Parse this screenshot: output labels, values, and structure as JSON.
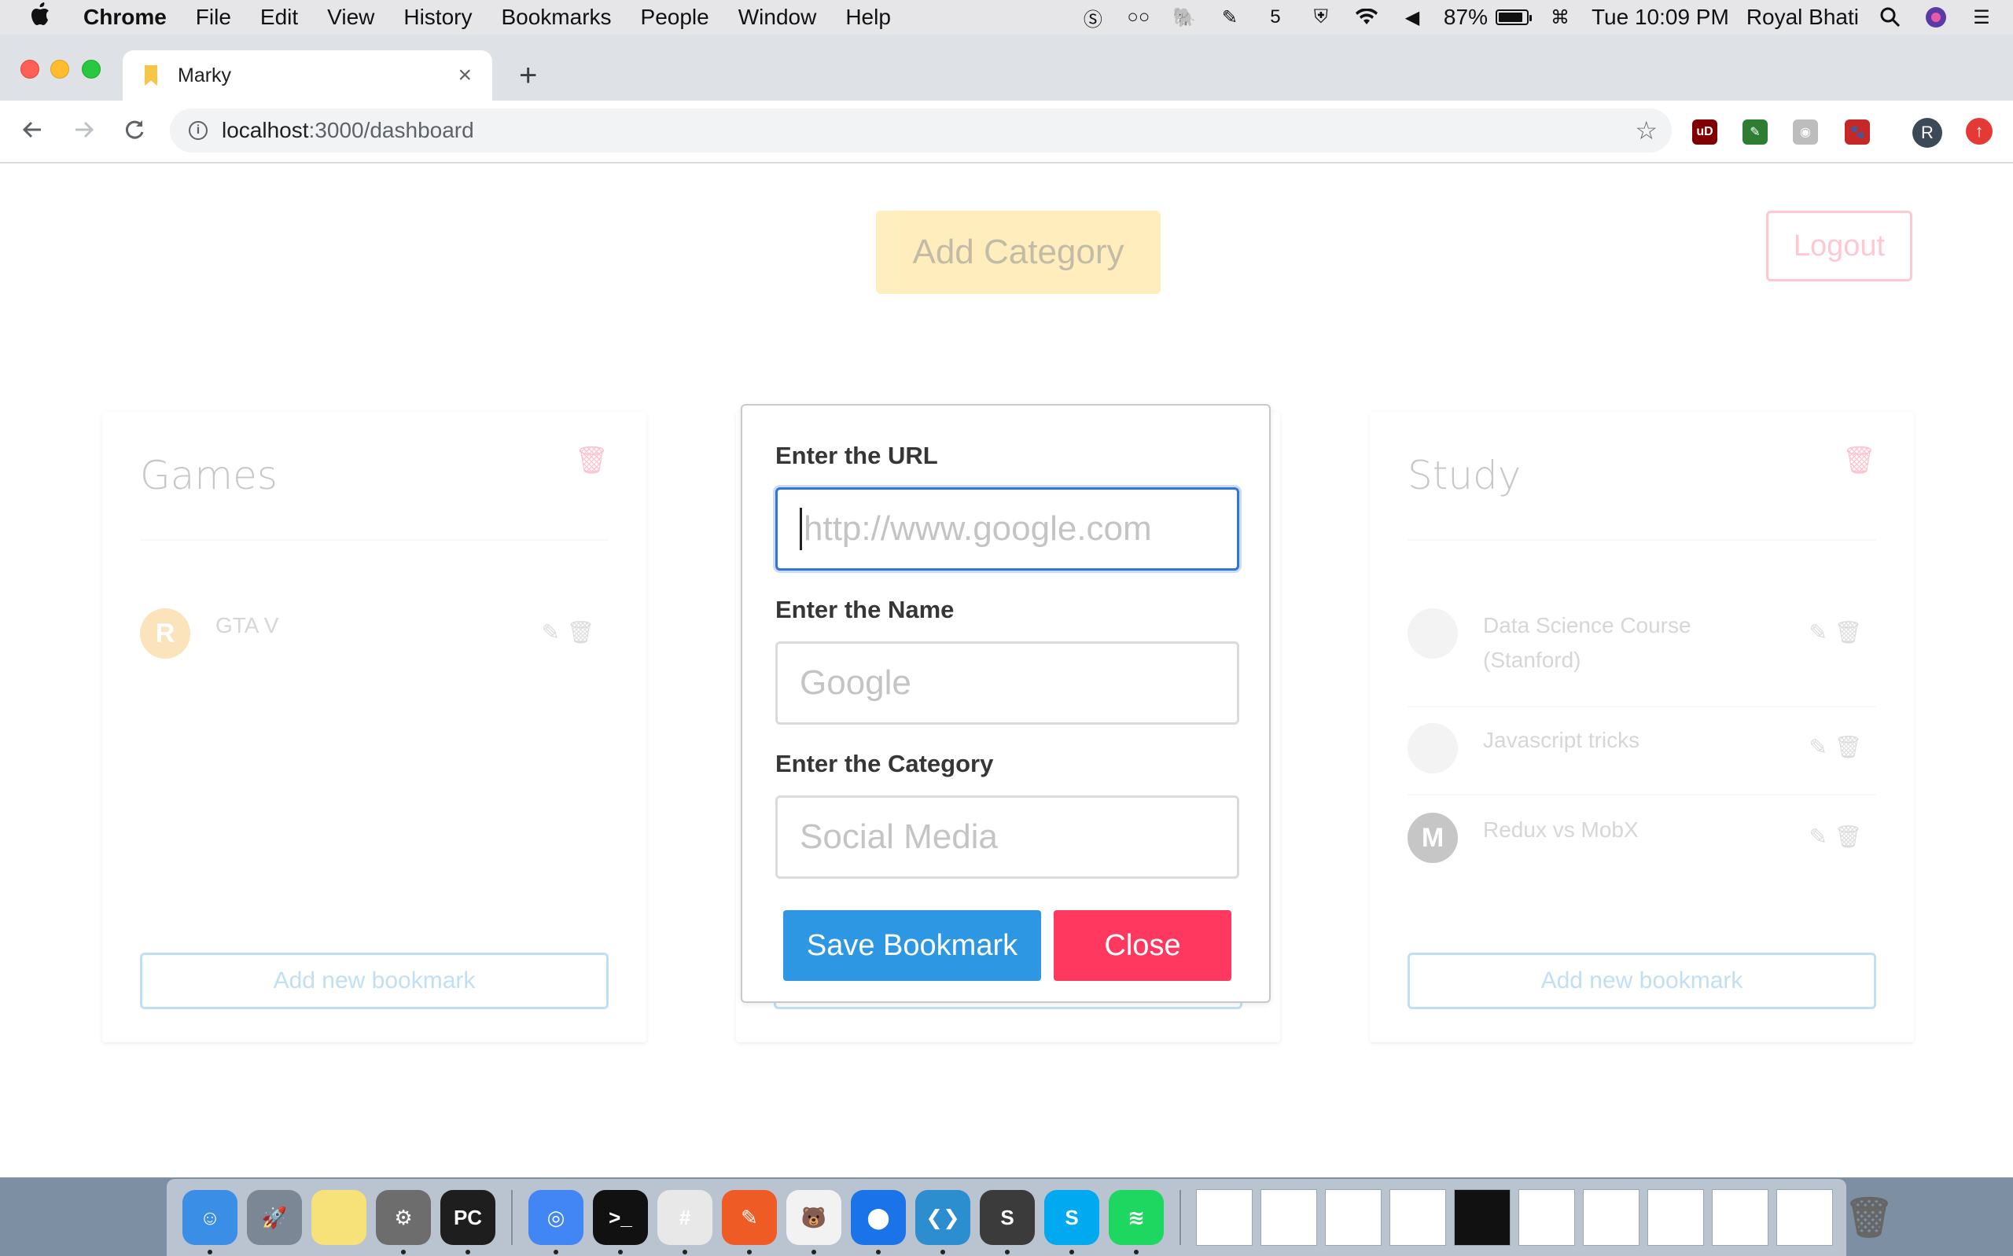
{
  "menubar": {
    "apple": "",
    "app_name": "Chrome",
    "items": [
      "File",
      "Edit",
      "View",
      "History",
      "Bookmarks",
      "People",
      "Window",
      "Help"
    ],
    "battery_percent": "87%",
    "battery_level": 0.87,
    "clock": "Tue 10:09 PM",
    "user": "Royal Bhati",
    "status_icons": [
      "skype-status-icon",
      "glasses-icon",
      "elephant-icon",
      "evernote-icon",
      "html5-icon",
      "extension-status-icon",
      "wifi-icon",
      "volume-icon"
    ]
  },
  "browser": {
    "tab_title": "Marky",
    "new_tab_symbol": "+",
    "close_tab_symbol": "×",
    "url_host": "localhost",
    "url_path": ":3000/dashboard",
    "profile_initial": "R",
    "extensions": [
      {
        "name": "ublock-icon",
        "color": "#800000",
        "label": "uD"
      },
      {
        "name": "colorpicker-icon",
        "color": "#2e7d32",
        "label": "✎"
      },
      {
        "name": "record-icon",
        "color": "#bdbdbd",
        "label": "◉"
      },
      {
        "name": "paw-icon",
        "color": "#c62828",
        "label": "🐾"
      }
    ]
  },
  "page": {
    "add_category_label": "Add Category",
    "logout_label": "Logout",
    "cards": [
      {
        "title": "Games",
        "add_label": "Add new bookmark",
        "bookmarks": [
          {
            "name": "GTA V",
            "avatar": "R",
            "avatar_color": "#f5a623"
          }
        ]
      },
      {
        "title": "Study",
        "add_label": "Add new bookmark",
        "bookmarks": [
          {
            "name": "Data Science Course (Stanford)",
            "avatar": "",
            "avatar_color": "#d9d9d9"
          },
          {
            "name": "Javascript tricks",
            "avatar": "",
            "avatar_color": "#d9d9d9"
          },
          {
            "name": "Redux vs MobX",
            "avatar": "M",
            "avatar_color": "#444444"
          }
        ]
      }
    ],
    "middle_add_label": ""
  },
  "modal": {
    "url_label": "Enter the URL",
    "url_placeholder": "http://www.google.com",
    "url_value": "",
    "name_label": "Enter the Name",
    "name_placeholder": "Google",
    "category_label": "Enter the Category",
    "category_placeholder": "Social Media",
    "save_label": "Save Bookmark",
    "close_label": "Close"
  },
  "dock": {
    "apps": [
      {
        "name": "finder-icon",
        "color": "#3a8ee6",
        "glyph": "☺",
        "running": true
      },
      {
        "name": "launchpad-icon",
        "color": "#7b8794",
        "glyph": "🚀",
        "running": false
      },
      {
        "name": "notes-icon",
        "color": "#f7e27a",
        "glyph": "",
        "running": false
      },
      {
        "name": "system-preferences-icon",
        "color": "#6d6d6d",
        "glyph": "⚙",
        "running": true
      },
      {
        "name": "pycharm-icon",
        "color": "#1e1e1e",
        "glyph": "PC",
        "running": true
      },
      {
        "name": "chrome-icon",
        "color": "#4285f4",
        "glyph": "◎",
        "running": true
      },
      {
        "name": "terminal-icon",
        "color": "#111111",
        "glyph": ">_",
        "running": true
      },
      {
        "name": "slack-icon",
        "color": "#e8e8e8",
        "glyph": "#",
        "running": true
      },
      {
        "name": "postman-icon",
        "color": "#ef5b25",
        "glyph": "✎",
        "running": true
      },
      {
        "name": "bear-icon",
        "color": "#f2f2f2",
        "glyph": "🐻",
        "running": true
      },
      {
        "name": "maps-pin-icon",
        "color": "#1a73e8",
        "glyph": "⬤",
        "running": true
      },
      {
        "name": "vscode-icon",
        "color": "#2c8ecf",
        "glyph": "❮❯",
        "running": true
      },
      {
        "name": "sublime-text-icon",
        "color": "#3b3b3b",
        "glyph": "S",
        "running": true
      },
      {
        "name": "skype-icon",
        "color": "#00a9f0",
        "glyph": "S",
        "running": true
      },
      {
        "name": "spotify-icon",
        "color": "#1ed760",
        "glyph": "≋",
        "running": true
      }
    ],
    "docs": [
      {
        "name": "zip-file-icon",
        "dark": false
      },
      {
        "name": "document-thumbnail",
        "dark": false
      },
      {
        "name": "pycharm-window-thumbnail",
        "dark": false
      },
      {
        "name": "spreadsheet-thumbnail",
        "dark": false
      },
      {
        "name": "terminal-window-thumbnail",
        "dark": true
      },
      {
        "name": "finder-window-thumbnail",
        "dark": false
      },
      {
        "name": "screenshot-thumbnail",
        "dark": false
      },
      {
        "name": "browser-window-thumbnail",
        "dark": false
      },
      {
        "name": "slack-window-thumbnail",
        "dark": false
      },
      {
        "name": "chrome-window-thumbnail",
        "dark": false
      }
    ],
    "trash": "trash-icon"
  }
}
